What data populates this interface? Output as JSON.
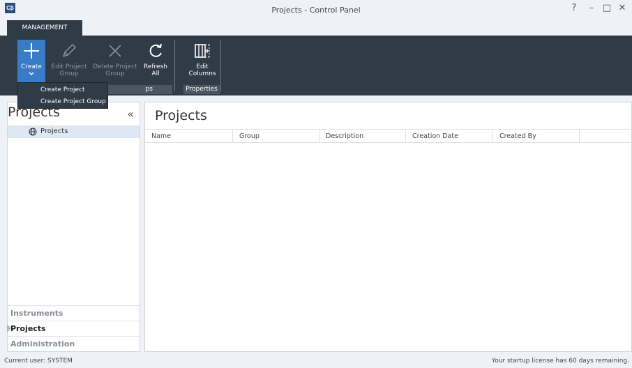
{
  "app": {
    "logo_text": "Cβ",
    "window_title": "Projects - Control Panel",
    "help_glyph": "?",
    "minimize_glyph": "–",
    "maximize_glyph": "□",
    "close_glyph": "✕"
  },
  "ribbon": {
    "tab_label": "MANAGEMENT",
    "buttons": {
      "create": "Create",
      "edit_project_group_1": "Edit Project",
      "edit_project_group_2": "Group",
      "delete_project_group_1": "Delete Project",
      "delete_project_group_2": "Group",
      "refresh_1": "Refresh",
      "refresh_2": "All",
      "edit_columns_1": "Edit",
      "edit_columns_2": "Columns"
    },
    "groups": {
      "projects_partial": "ps",
      "properties": "Properties"
    },
    "dropdown": [
      "Create Project",
      "Create Project Group"
    ],
    "icons": [
      "plus-icon",
      "pencil-icon",
      "x-icon",
      "refresh-icon",
      "columns-icon",
      "chevron-down-icon"
    ]
  },
  "left_panel": {
    "title": "Projects",
    "collapse_glyph": "«",
    "tree_item": "Projects",
    "nav": [
      "Instruments",
      "Projects",
      "Administration"
    ]
  },
  "main": {
    "title": "Projects",
    "columns": [
      "Name",
      "Group",
      "Description",
      "Creation Date",
      "Created By"
    ]
  },
  "status": {
    "user": "Current user: SYSTEM",
    "license": "Your startup license has 60 days remaining."
  },
  "colors": {
    "ribbon_bg": "#2f3b47",
    "accent": "#3a7bc8",
    "selection": "#dde8f2"
  }
}
